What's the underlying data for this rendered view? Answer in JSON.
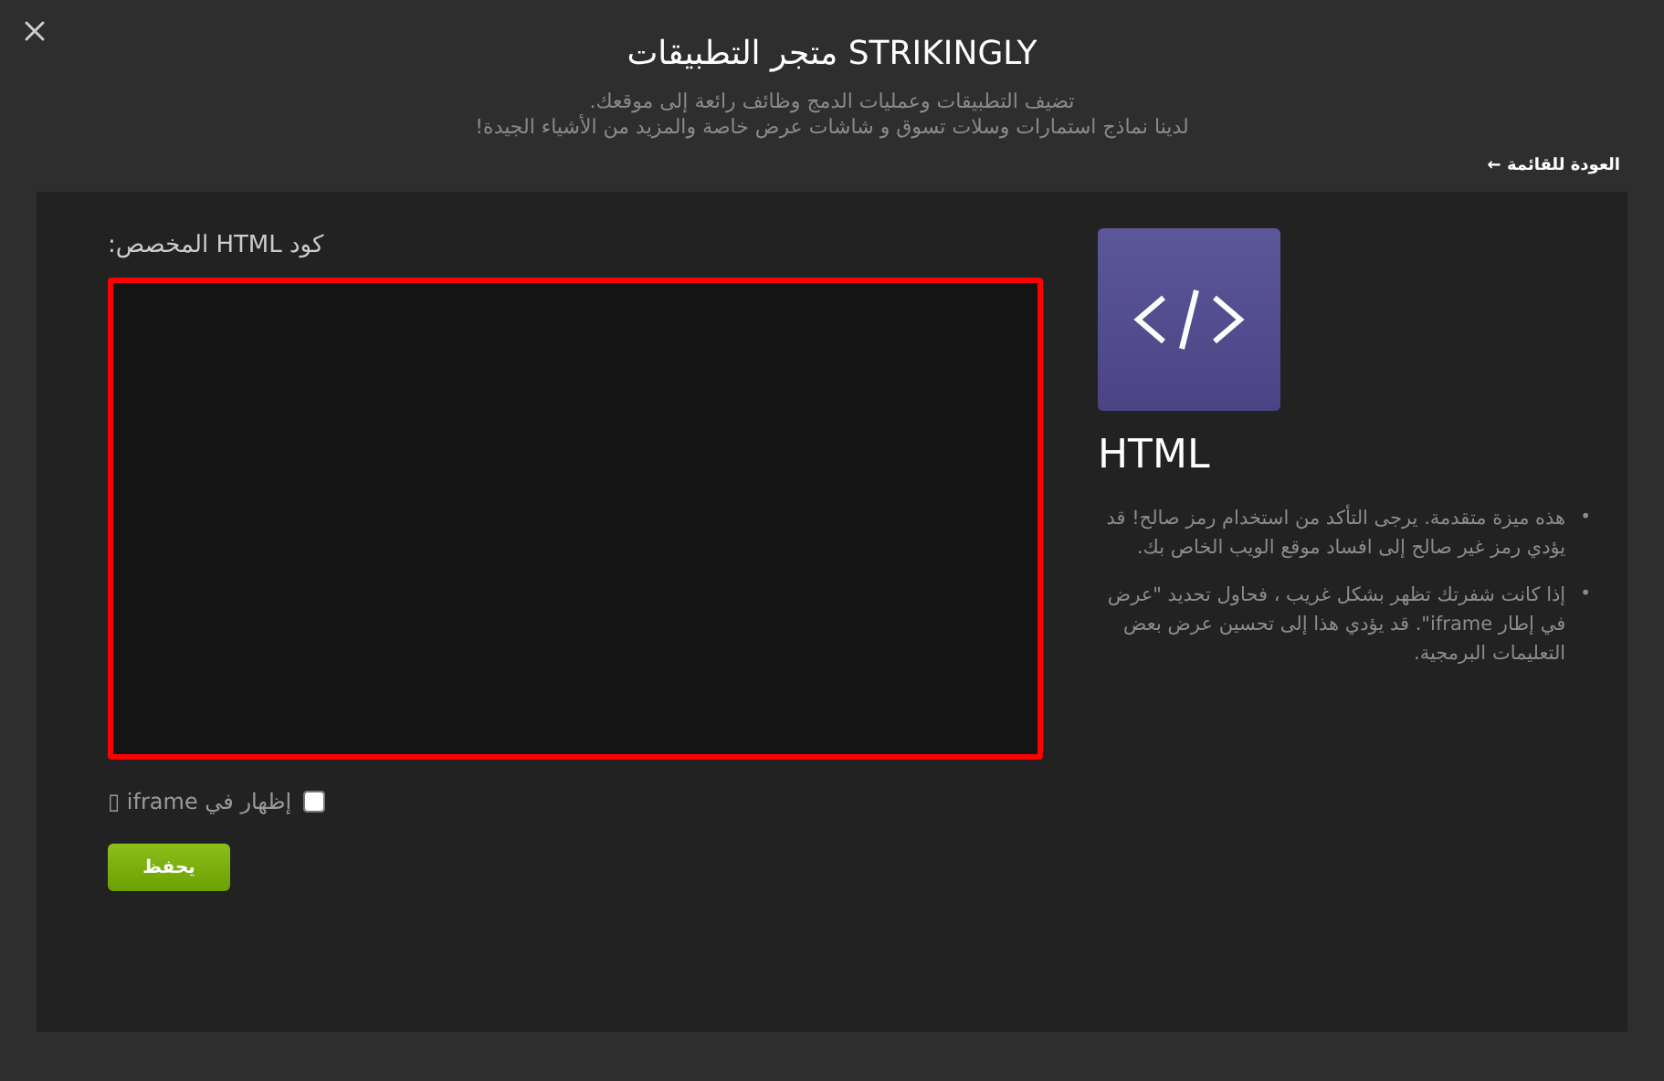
{
  "title": "متجر التطبيقات STRIKINGLY",
  "subtitle_lines": [
    "تضيف التطبيقات وعمليات الدمج وظائف رائعة إلى موقعك.",
    "لدينا نماذج استمارات وسلات تسوق و شاشات عرض خاصة والمزيد من الأشياء الجيدة!"
  ],
  "back_link": "العودة للقائمة ←",
  "app": {
    "name": "HTML",
    "notes": [
      {
        "bullet": "•",
        "text": "هذه ميزة متقدمة. يرجى التأكد من استخدام رمز صالح! قد يؤدي رمز غير صالح إلى افساد موقع الويب الخاص بك."
      },
      {
        "bullet": "•",
        "text": "إذا كانت شفرتك تظهر بشكل غريب ، فحاول تحديد \"عرض في إطار iframe\". قد يؤدي هذا إلى تحسين عرض بعض التعليمات البرمجية."
      }
    ]
  },
  "editor": {
    "label": "كود HTML المخصص:",
    "invalid": true
  },
  "iframe_option": {
    "label": "إظهار في iframe ▯",
    "checked": false
  },
  "save_button": "يحفظ"
}
